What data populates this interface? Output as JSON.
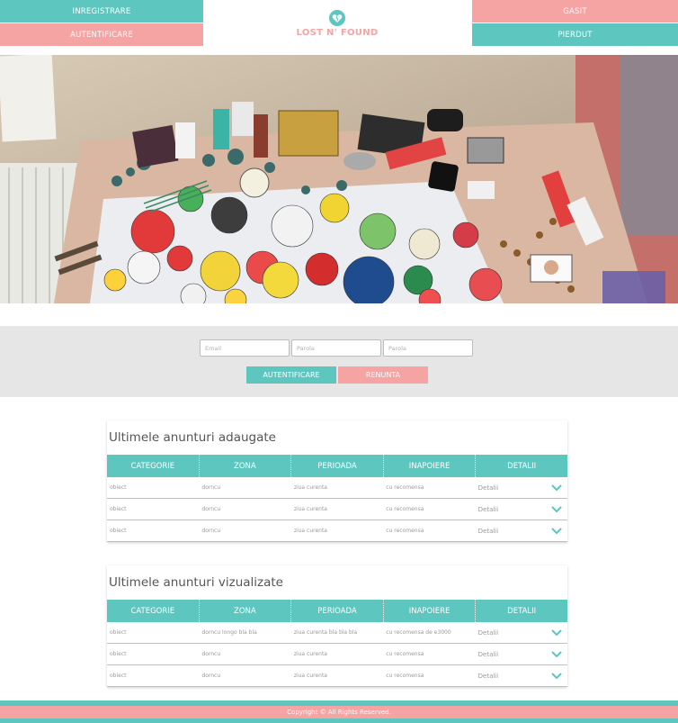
{
  "header": {
    "nav_left": [
      "INREGISTRARE",
      "AUTENTIFICARE"
    ],
    "nav_right": [
      "GASIT",
      "PIERDUT"
    ],
    "logo_text": "LOST N' FOUND",
    "logo_icon": "broken-heart-icon"
  },
  "hero": {
    "icon": "lost-items-photo"
  },
  "login": {
    "email_placeholder": "Email",
    "password_placeholder": "Parola",
    "password_confirm_placeholder": "Parola",
    "submit_label": "AUTENTIFICARE",
    "cancel_label": "RENUNTA"
  },
  "recent_added": {
    "title": "Ultimele anunturi adaugate",
    "columns": [
      "CATEGORIE",
      "ZONA",
      "PERIOADA",
      "INAPOIERE",
      "DETALII"
    ],
    "rows": [
      {
        "categorie": "obiect",
        "zona": "dorncu",
        "perioada": "ziua curenta",
        "inapoiere": "cu recomensa",
        "detalii": "Detalii"
      },
      {
        "categorie": "obiect",
        "zona": "dorncu",
        "perioada": "ziua curenta",
        "inapoiere": "cu recomensa",
        "detalii": "Detalii"
      },
      {
        "categorie": "obiect",
        "zona": "dorncu",
        "perioada": "ziua curenta",
        "inapoiere": "cu recomensa",
        "detalii": "Detalii"
      }
    ]
  },
  "recent_viewed": {
    "title": "Ultimele anunturi vizualizate",
    "columns": [
      "CATEGORIE",
      "ZONA",
      "PERIOADA",
      "INAPOIERE",
      "DETALII"
    ],
    "rows": [
      {
        "categorie": "obiect",
        "zona": "dorncu longo bla bla",
        "perioada": "ziua curenta bla bla bla",
        "inapoiere": "cu recomensa de e3000",
        "detalii": "Detalii"
      },
      {
        "categorie": "obiect",
        "zona": "dorncu",
        "perioada": "ziua curenta",
        "inapoiere": "cu recomensa",
        "detalii": "Detalii"
      },
      {
        "categorie": "obiect",
        "zona": "dorncu",
        "perioada": "ziua curenta",
        "inapoiere": "cu recomensa",
        "detalii": "Detalii"
      }
    ]
  },
  "footer": {
    "copyright": "Copyright © All Rights Reserved."
  },
  "colors": {
    "teal": "#5cc6bf",
    "pink": "#f6a3a3",
    "band": "#e6e6e6"
  }
}
